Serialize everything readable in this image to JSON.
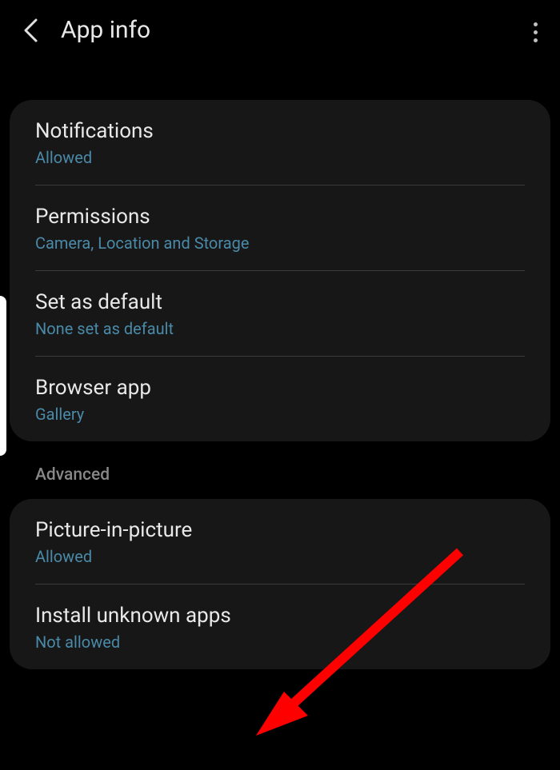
{
  "header": {
    "title": "App info"
  },
  "settings_group1": [
    {
      "title": "Notifications",
      "subtitle": "Allowed"
    },
    {
      "title": "Permissions",
      "subtitle": "Camera, Location and Storage"
    },
    {
      "title": "Set as default",
      "subtitle": "None set as default"
    },
    {
      "title": "Browser app",
      "subtitle": "Gallery"
    }
  ],
  "section_header": "Advanced",
  "settings_group2": [
    {
      "title": "Picture-in-picture",
      "subtitle": "Allowed"
    },
    {
      "title": "Install unknown apps",
      "subtitle": "Not allowed"
    }
  ]
}
